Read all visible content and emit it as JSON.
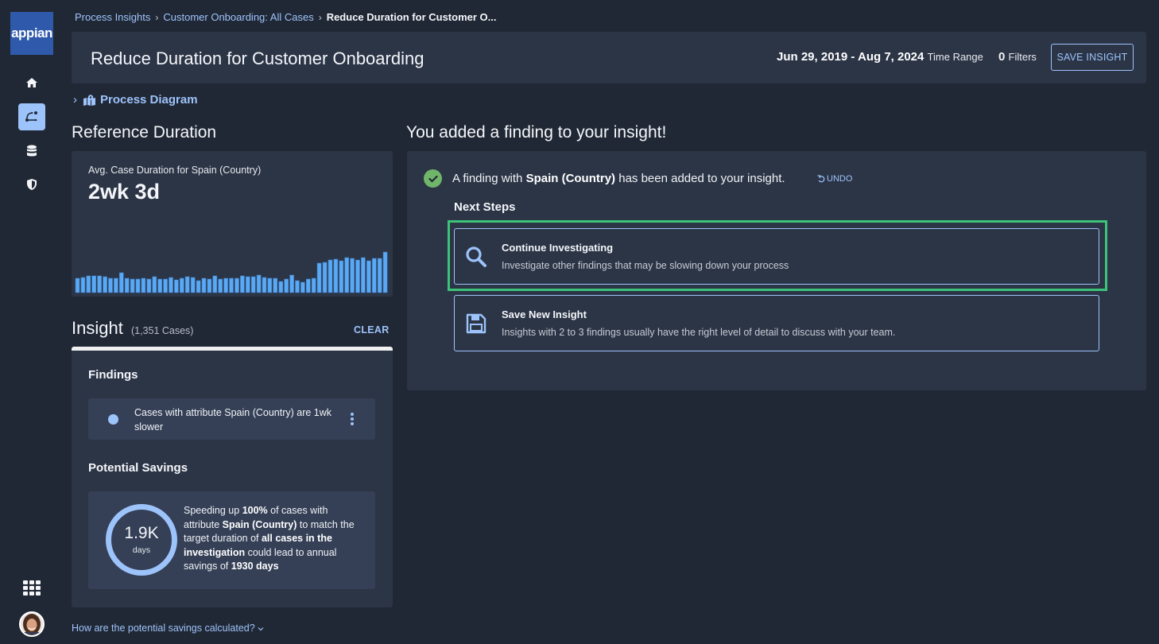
{
  "app": {
    "logo_text": "appian",
    "nav": [
      {
        "name": "home",
        "icon": "home-icon",
        "active": false
      },
      {
        "name": "process-insights",
        "icon": "process-flow-icon",
        "active": true
      },
      {
        "name": "data",
        "icon": "database-icon",
        "active": false
      },
      {
        "name": "security",
        "icon": "shield-icon",
        "active": false
      }
    ],
    "bottom_nav": {
      "apps_icon": "grid-icon",
      "avatar": "user-avatar"
    }
  },
  "breadcrumb": {
    "items": [
      "Process Insights",
      "Customer Onboarding: All Cases"
    ],
    "current": "Reduce Duration for Customer O...",
    "separator": "›"
  },
  "header": {
    "title": "Reduce Duration for Customer Onboarding",
    "date_range": "Jun 29, 2019 - Aug 7, 2024",
    "date_range_label": "Time Range",
    "filters_count": "0",
    "filters_label": "Filters",
    "save_button": "SAVE INSIGHT"
  },
  "process_diagram": {
    "label": "Process Diagram",
    "expand_glyph": "›"
  },
  "reference": {
    "title": "Reference Duration",
    "metric_label": "Avg. Case Duration for Spain (Country)",
    "metric_value": "2wk 3d",
    "bar_color": "#5aa9f5"
  },
  "chart_data": {
    "type": "bar",
    "title": "Avg. Case Duration for Spain (Country)",
    "xlabel": "",
    "ylabel": "",
    "note": "Sparkline without axes; values are relative heights",
    "values": [
      18,
      19,
      21,
      21,
      21,
      20,
      18,
      18,
      25,
      18,
      17,
      17,
      18,
      17,
      20,
      17,
      17,
      19,
      16,
      18,
      20,
      19,
      15,
      18,
      17,
      21,
      17,
      18,
      18,
      18,
      21,
      20,
      20,
      22,
      19,
      18,
      18,
      14,
      17,
      22,
      15,
      13,
      17,
      18,
      37,
      38,
      41,
      42,
      40,
      44,
      43,
      41,
      44,
      40,
      43,
      43,
      51
    ],
    "ylim": [
      0,
      52
    ]
  },
  "insight": {
    "title": "Insight",
    "cases": "(1,351 Cases)",
    "clear_label": "CLEAR",
    "findings_heading": "Findings",
    "findings": [
      {
        "text": "Cases with attribute Spain (Country) are 1wk slower",
        "color": "#9dc3fb"
      }
    ],
    "savings_heading": "Potential Savings",
    "savings_value": "1.9K",
    "savings_unit": "days",
    "savings_text": {
      "p1": "Speeding up ",
      "b1": "100%",
      "p2": " of cases with attribute ",
      "b2": "Spain (Country)",
      "p3": " to match the target duration of ",
      "b3": "all cases in the investigation",
      "p4": " could lead to annual savings of ",
      "b4": "1930 days"
    },
    "how_link": "How are the potential savings calculated?"
  },
  "confirmation": {
    "title": "You added a finding to your insight!",
    "msg_pre": "A finding with ",
    "msg_bold": "Spain (Country)",
    "msg_post": " has been added to your insight.",
    "undo_label": "UNDO",
    "next_steps_label": "Next Steps",
    "steps": [
      {
        "title": "Continue Investigating",
        "description": "Investigate other findings that may be slowing down your process",
        "icon": "search-icon",
        "focused": true
      },
      {
        "title": "Save New Insight",
        "description": "Insights with 2 to 3 findings usually have the right level of detail to discuss with your team.",
        "icon": "save-icon",
        "focused": false
      }
    ]
  },
  "colors": {
    "accent": "#9dc3fb",
    "success": "#6fb56a",
    "focus": "#3cc37a",
    "brand": "#2f5aab"
  }
}
